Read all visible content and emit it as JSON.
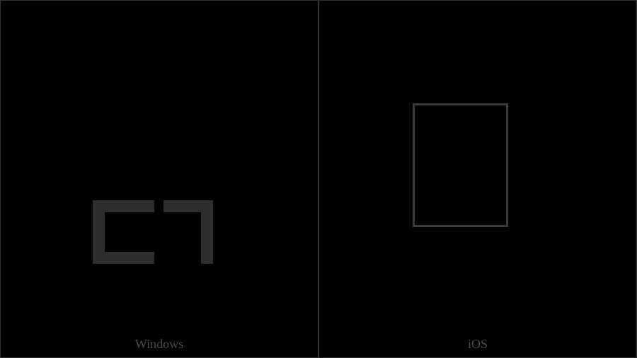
{
  "panels": [
    {
      "label": "Windows",
      "glyph_type": "broken-bracket-glyph"
    },
    {
      "label": "iOS",
      "glyph_type": "missing-glyph-box"
    }
  ],
  "colors": {
    "background": "#000000",
    "border": "#333333",
    "glyph": "#2d2d2d",
    "label": "#4a4a4a"
  }
}
